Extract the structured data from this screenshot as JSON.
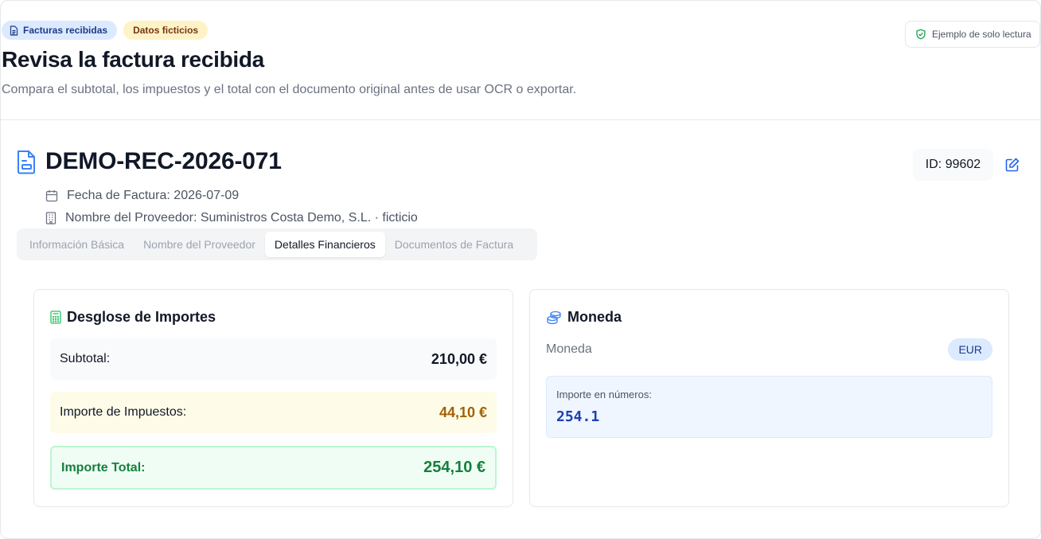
{
  "header": {
    "badges": {
      "received": "Facturas recibidas",
      "fictitious": "Datos ficticios"
    },
    "title": "Revisa la factura recibida",
    "subtitle": "Compara el subtotal, los impuestos y el total con el documento original antes de usar OCR o exportar.",
    "readonly": "Ejemplo de solo lectura"
  },
  "invoice": {
    "number": "DEMO-REC-2026-071",
    "date": "Fecha de Factura: 2026-07-09",
    "supplier": "Nombre del Proveedor: Suministros Costa Demo, S.L. · ficticio",
    "id": "ID: 99602"
  },
  "tabs": [
    {
      "label": "Información Básica",
      "active": false
    },
    {
      "label": "Nombre del Proveedor",
      "active": false
    },
    {
      "label": "Detalles Financieros",
      "active": true
    },
    {
      "label": "Documentos de Factura",
      "active": false
    }
  ],
  "breakdown": {
    "title": "Desglose de Importes",
    "subtotal_label": "Subtotal:",
    "subtotal_value": "210,00 €",
    "tax_label": "Importe de Impuestos:",
    "tax_value": "44,10 €",
    "total_label": "Importe Total:",
    "total_value": "254,10 €"
  },
  "currency": {
    "title": "Moneda",
    "label": "Moneda",
    "code": "EUR",
    "numbers_label": "Importe en números:",
    "numbers_value": "254.1"
  },
  "colors": {
    "accent_blue": "#2563eb",
    "tax_amber": "#a16207",
    "total_green": "#15803d"
  },
  "icons": [
    "document-icon",
    "shield-check-icon",
    "invoice-document-icon",
    "calendar-icon",
    "building-icon",
    "edit-icon",
    "calculator-icon",
    "coins-icon"
  ]
}
